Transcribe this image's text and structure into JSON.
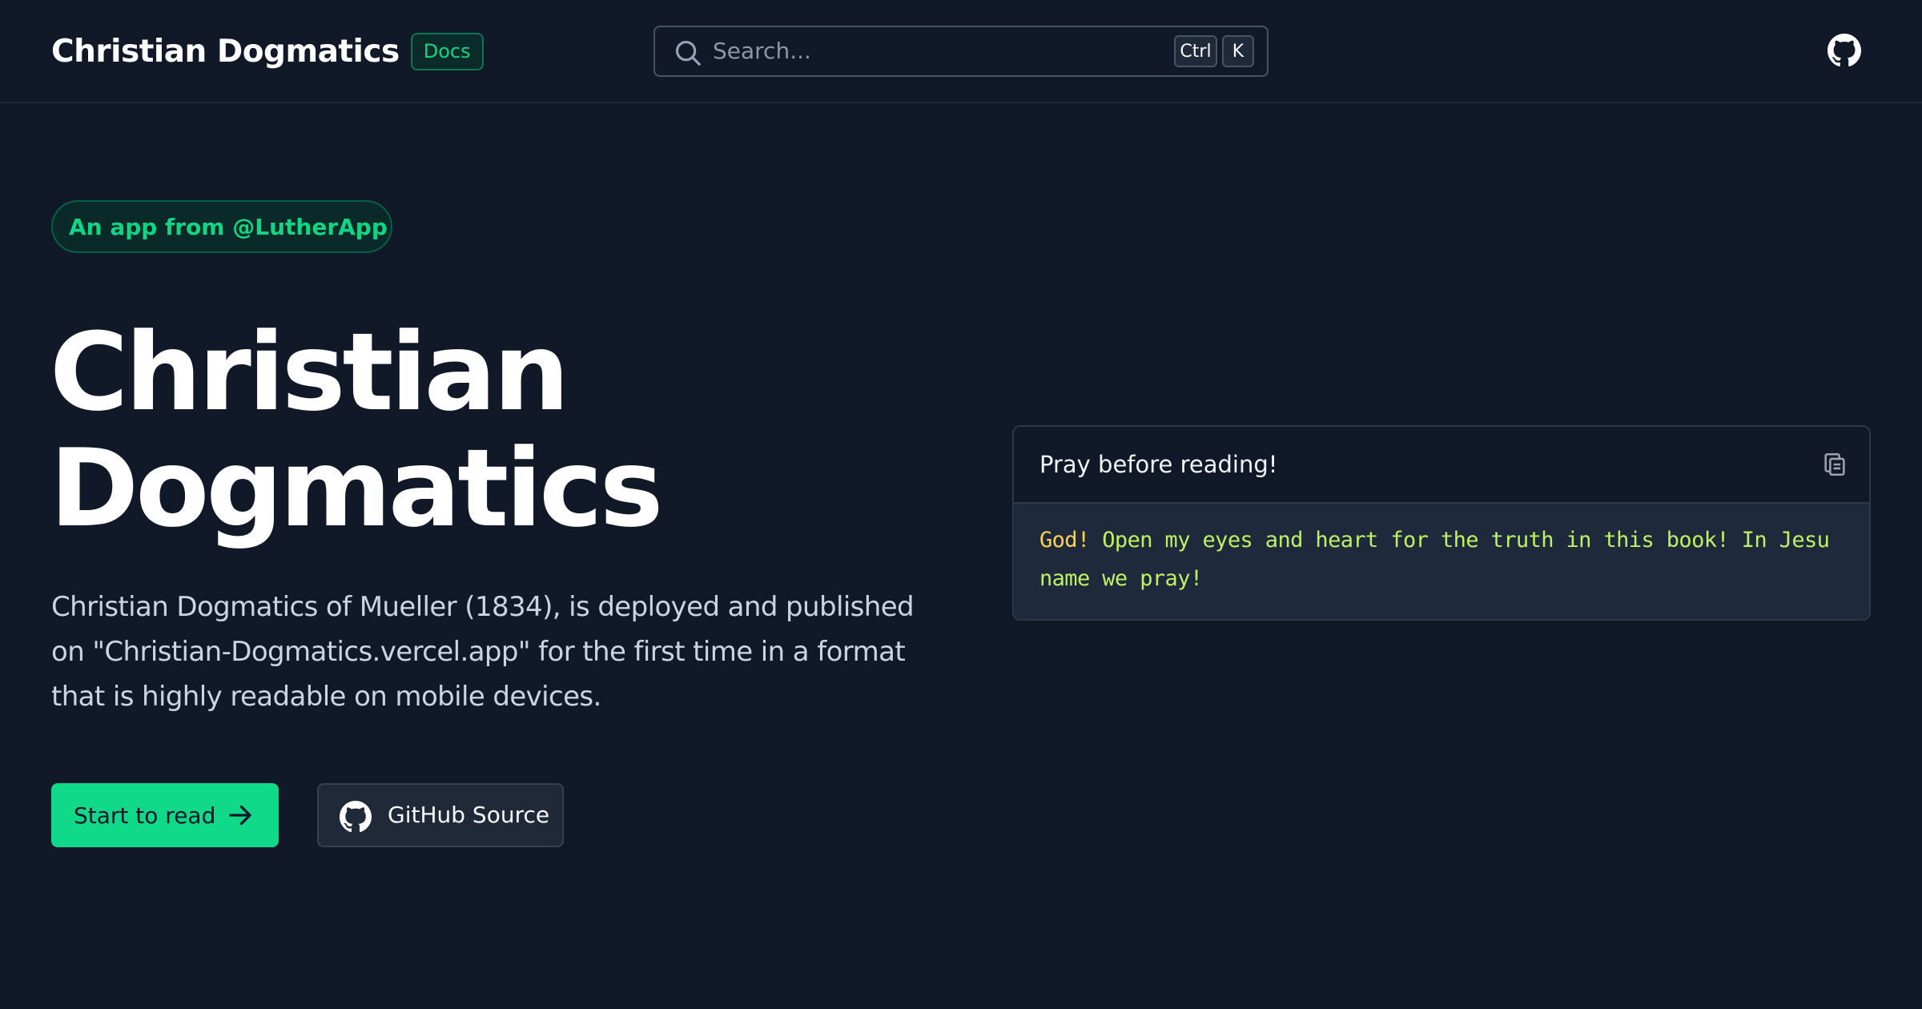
{
  "header": {
    "brand": "Christian Dogmatics",
    "badge": "Docs",
    "search_placeholder": "Search...",
    "shortcut_ctrl": "Ctrl",
    "shortcut_key": "K"
  },
  "hero": {
    "pill": "An app from @LutherApp",
    "title_line1": "Christian",
    "title_line2": "Dogmatics",
    "description": "Christian Dogmatics of Mueller (1834), is deployed and published on \"Christian-Dogmatics.vercel.app\" for the first time in a format that is highly readable on mobile devices.",
    "primary_button": "Start to read",
    "secondary_button": "GitHub Source"
  },
  "code_card": {
    "title": "Pray before reading!",
    "code_first_word": "God!",
    "code_rest": " Open my eyes and heart for the truth in this book! In Jesu name we pray!"
  },
  "colors": {
    "background": "#111827",
    "accent": "#10d98a",
    "code_keyword": "#fcd34d",
    "code_text": "#bef264"
  },
  "icons": [
    "search-icon",
    "github-icon",
    "external-link-icon",
    "arrow-right-icon",
    "copy-icon"
  ]
}
